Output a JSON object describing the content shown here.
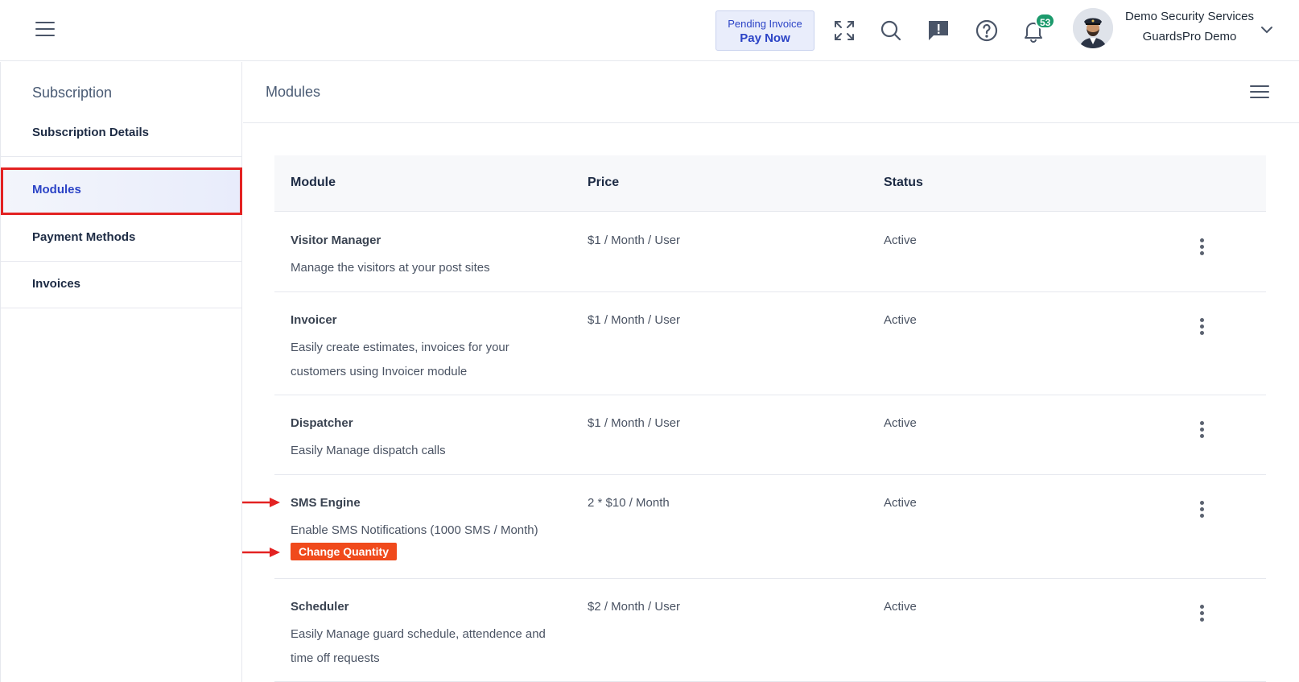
{
  "header": {
    "menu_icon": "hamburger-icon",
    "pending": {
      "line1": "Pending Invoice",
      "line2": "Pay Now"
    },
    "icons": [
      "fullscreen-icon",
      "search-icon",
      "feedback-icon",
      "help-icon",
      "bell-icon"
    ],
    "notification_count": "53",
    "user": {
      "name": "Demo Security Services",
      "org": "GuardsPro Demo"
    }
  },
  "sidebar": {
    "title": "Subscription",
    "items": [
      {
        "label": "Subscription Details"
      },
      {
        "label": "Modules",
        "active": true
      },
      {
        "label": "Payment Methods"
      },
      {
        "label": "Invoices"
      }
    ]
  },
  "main": {
    "title": "Modules",
    "columns": {
      "module": "Module",
      "price": "Price",
      "status": "Status"
    },
    "rows": [
      {
        "name": "Visitor Manager",
        "desc": "Manage the visitors at your post sites",
        "price": "$1 / Month / User",
        "status": "Active"
      },
      {
        "name": "Invoicer",
        "desc": "Easily create estimates, invoices for your customers using Invoicer module",
        "price": "$1 / Month / User",
        "status": "Active"
      },
      {
        "name": "Dispatcher",
        "desc": "Easily Manage dispatch calls",
        "price": "$1 / Month / User",
        "status": "Active"
      },
      {
        "name": "SMS Engine",
        "desc": "Enable SMS Notifications (1000 SMS / Month)",
        "price": "2 * $10 / Month",
        "status": "Active",
        "action": "Change Quantity"
      },
      {
        "name": "Scheduler",
        "desc": "Easily Manage guard schedule, attendence and time off requests",
        "price": "$2 / Month / User",
        "status": "Active"
      }
    ]
  },
  "colors": {
    "accent": "#2b43c6",
    "highlight": "#e32222",
    "button": "#f04a1c",
    "badge": "#1c9a6c"
  }
}
